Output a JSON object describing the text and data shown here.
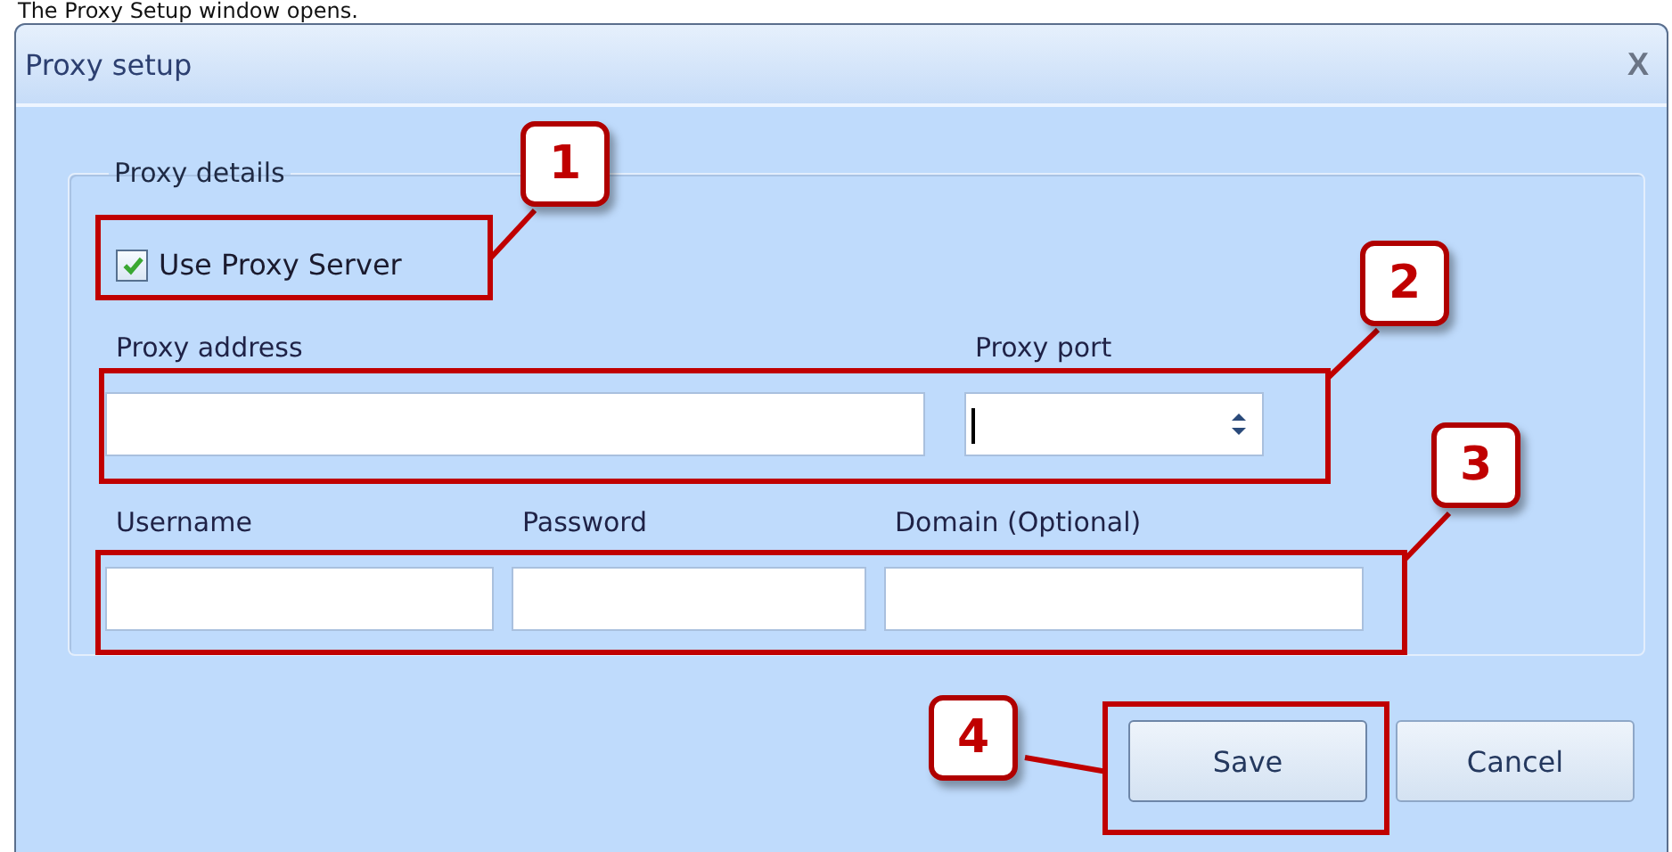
{
  "caption": "The Proxy Setup window opens.",
  "window": {
    "title": "Proxy setup",
    "close": "X"
  },
  "group": {
    "title": "Proxy details",
    "use_proxy": {
      "label": "Use Proxy Server",
      "checked": true
    },
    "address": {
      "label": "Proxy address"
    },
    "port": {
      "label": "Proxy port",
      "focused": true
    },
    "credentials": [
      {
        "label": "Username"
      },
      {
        "label": "Password"
      },
      {
        "label": "Domain (Optional)"
      }
    ]
  },
  "buttons": [
    {
      "label": "Save",
      "kind": "primary"
    },
    {
      "label": "Cancel",
      "kind": "secondary"
    }
  ],
  "annotations": [
    {
      "number": "1"
    },
    {
      "number": "2"
    },
    {
      "number": "3"
    },
    {
      "number": "4"
    }
  ]
}
